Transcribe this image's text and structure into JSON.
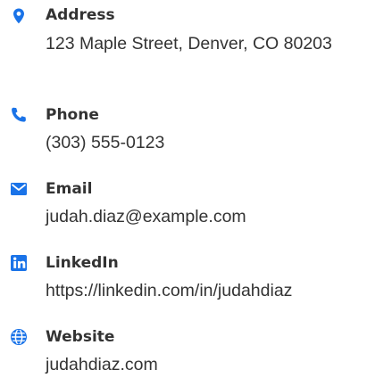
{
  "colors": {
    "accent": "#1a73e8",
    "text": "#333333",
    "background": "#ffffff"
  },
  "contacts": [
    {
      "icon": "map-pin-icon",
      "label": "Address",
      "value": "123 Maple Street, Denver, CO 80203"
    },
    {
      "icon": "phone-icon",
      "label": "Phone",
      "value": "(303) 555-0123"
    },
    {
      "icon": "envelope-icon",
      "label": "Email",
      "value": "judah.diaz@example.com"
    },
    {
      "icon": "linkedin-icon",
      "label": "LinkedIn",
      "value": "https://linkedin.com/in/judahdiaz"
    },
    {
      "icon": "globe-icon",
      "label": "Website",
      "value": "judahdiaz.com"
    }
  ]
}
